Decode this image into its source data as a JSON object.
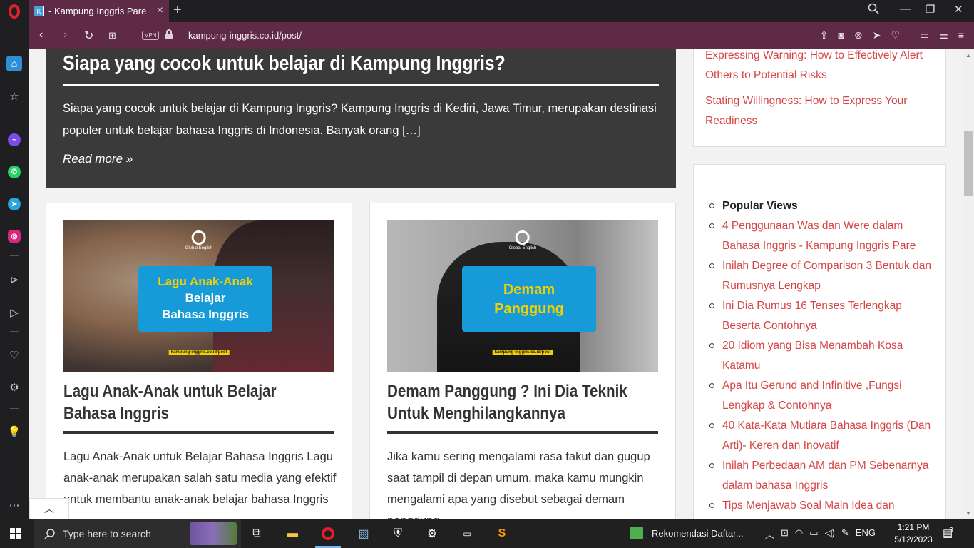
{
  "browser": {
    "tab_title": "- Kampung Inggris Pare",
    "url": "kampung-inggris.co.id/post/",
    "vpn_label": "VPN"
  },
  "featured": {
    "title": "Siapa yang cocok untuk belajar di Kampung Inggris?",
    "excerpt": "Siapa yang cocok untuk belajar di Kampung Inggris? Kampung Inggris di Kediri, Jawa Timur, merupakan destinasi populer untuk belajar bahasa Inggris di Indonesia. Banyak orang […]",
    "read_more": "Read more »"
  },
  "posts": [
    {
      "title": "Lagu Anak-Anak untuk Belajar Bahasa Inggris",
      "excerpt": "Lagu Anak-Anak untuk Belajar Bahasa Inggris Lagu anak-anak merupakan salah satu media yang efektif untuk membantu anak-anak belajar bahasa Inggris",
      "thumb_brand": "Global English",
      "thumb_text": [
        "Lagu Anak-Anak",
        "Belajar",
        "Bahasa Inggris"
      ],
      "thumb_url": "kampung-inggris.co.id/post"
    },
    {
      "title": "Demam Panggung ? Ini Dia Teknik Untuk Menghilangkannya",
      "excerpt": "Jika kamu sering mengalami rasa takut dan gugup saat tampil di depan umum, maka kamu mungkin mengalami apa yang disebut sebagai demam panggung",
      "thumb_brand": "Global English",
      "thumb_text": [
        "Demam",
        "Panggung"
      ],
      "thumb_url": "kampung-inggris.co.id/post"
    }
  ],
  "recent_links": [
    "Expressing Warning: How to Effectively Alert Others to Potential Risks",
    "Stating Willingness: How to Express Your Readiness"
  ],
  "popular": {
    "heading": "Popular Views",
    "items": [
      "4 Penggunaan Was dan Were dalam Bahasa Inggris - Kampung Inggris Pare",
      "Inilah Degree of Comparison 3 Bentuk dan Rumusnya Lengkap",
      "Ini Dia Rumus 16 Tenses Terlengkap Beserta Contohnya",
      "20 Idiom yang Bisa Menambah Kosa Katamu",
      "Apa Itu Gerund and Infinitive ,Fungsi Lengkap & Contohnya",
      "40 Kata-Kata Mutiara Bahasa Inggris (Dan Arti)- Keren dan Inovatif",
      "Inilah Perbedaan AM dan PM Sebenarnya dalam bahasa Inggris",
      "Tips Menjawab Soal Main Idea dan"
    ]
  },
  "taskbar": {
    "search_placeholder": "Type here to search",
    "notification": "Rekomendasi Daftar...",
    "language": "ENG",
    "time": "1:21 PM",
    "date": "5/12/2023",
    "notif_count": "3"
  },
  "colors": {
    "opera_red": "#e0202a",
    "chrome_purple": "#5e2a46",
    "link_red": "#d64545",
    "thumb_blue": "#169ad8",
    "thumb_yellow": "#f5d000"
  }
}
